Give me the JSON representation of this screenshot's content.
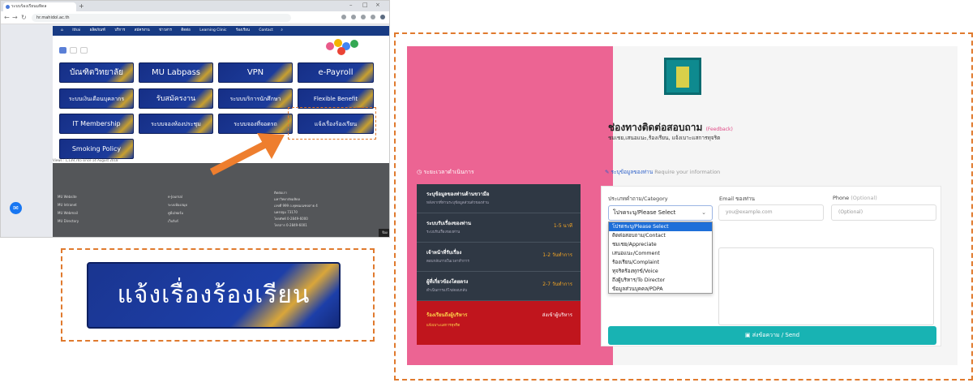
{
  "browser": {
    "tab_title": "ระบบร้องเรียนมหิดล",
    "url": "hr.mahidol.ac.th",
    "nav_items": [
      "Ithai",
      "ผลิตภัณฑ์",
      "บริการ",
      "สมัครงาน",
      "ข่าวสาร",
      "ติดต่อ",
      "Learning Clinic",
      "ร้องเรียน",
      "Contact"
    ],
    "buttons": [
      "บัณฑิตวิทยาลัย",
      "MU Labpass",
      "VPN",
      "e-Payroll",
      "ระบบเงินเดือนบุคลากร",
      "รับสมัครงาน",
      "ระบบบริการนักศึกษา",
      "Flexible Benefit",
      "IT Membership",
      "ระบบจองห้องประชุม",
      "ระบบจองที่จอดรถ",
      "แจ้งเรื่องร้องเรียน",
      "Smoking Policy"
    ],
    "stats": "Views : 1,139,765 since 14 August 2018",
    "footer_col1": [
      "MU Website",
      "MU Intranet",
      "MU Webmail",
      "MU Directory"
    ],
    "footer_col2": [
      "e-Journal",
      "ระบบห้องสมุด",
      "คู่มือ/ฟอร์ม",
      "เว็บลิงก์"
    ],
    "footer_col3": [
      "ติดต่อเรา",
      "มหาวิทยาลัยมหิดล",
      "เลขที่ 999 ถ.พุทธมณฑลสาย 4",
      "นครปฐม 73170",
      "โทรศัพท์ 0-2849-6000",
      "โทรสาร 0-2849-6001"
    ],
    "feedback_tab": "ร้องเรียน",
    "messenger_icon": "messenger-icon"
  },
  "zoom_label": "แจ้งเรื่องร้องเรียน",
  "contact": {
    "title": "ช่องทางติดต่อสอบถาม",
    "title_tag": "(Feedback)",
    "subtitle": "ชมเชย,เสนอแนะ,ร้องเรียน, แจ้งเบาะแสการทุจริต",
    "process_time_label": "ระยะเวลาดำเนินการ",
    "required_info": "ระบุข้อมูลของท่าน",
    "required_info_en": "Require your information",
    "timeline": [
      {
        "title": "ระบุข้อมูลของท่านด้านขวามือ",
        "sub": "หลังจากที่ท่านระบุข้อมูลส่วนตัวของท่าน",
        "time": ""
      },
      {
        "title": "ระบบรับเรื่องของท่าน",
        "sub": "ระบบรับเรื่องของท่าน",
        "time": "1-5 นาที"
      },
      {
        "title": "เจ้าหน้าที่รับเรื่อง",
        "sub": "ตอบกลับภายในเวลาทำการ",
        "time": "1-2 วันทำการ"
      },
      {
        "title": "ผู้ที่เกี่ยวข้องโดยตรง",
        "sub": "ดำเนินการแก้ไข/ตอบกลับ",
        "time": "2-7 วันทำการ"
      },
      {
        "title": "ร้องเรียนถึงผู้บริหาร",
        "sub": "แจ้งเบาะแสการทุจริต",
        "time": "ส่งเข้าผู้บริหาร"
      }
    ],
    "form": {
      "category_label": "ประเภทคำถาม/Category",
      "category_value": "โปรดระบุ/Please Select",
      "email_label": "Email ของท่าน",
      "email_placeholder": "you@example.com",
      "phone_label": "Phone",
      "phone_optional": "(Optional)",
      "phone_placeholder": "(Optional)",
      "options": [
        "โปรดระบุ/Please Select",
        "ติดต่อสอบถาม/Contact",
        "ชมเชย/Appreciate",
        "เสนอแนะ/Comment",
        "ร้องเรียน/Complaint",
        "ทุจริตร้องทุกข์/Voice",
        "ถึงผู้บริหาร/To Director",
        "ข้อมูลส่วนบุคคล/PDPA"
      ],
      "send_label": "ส่งข้อความ / Send"
    }
  },
  "colors": {
    "highlight": "#e07a2e",
    "pink": "#ec6493",
    "teal": "#18b3b3",
    "navy": "#1a3590"
  }
}
